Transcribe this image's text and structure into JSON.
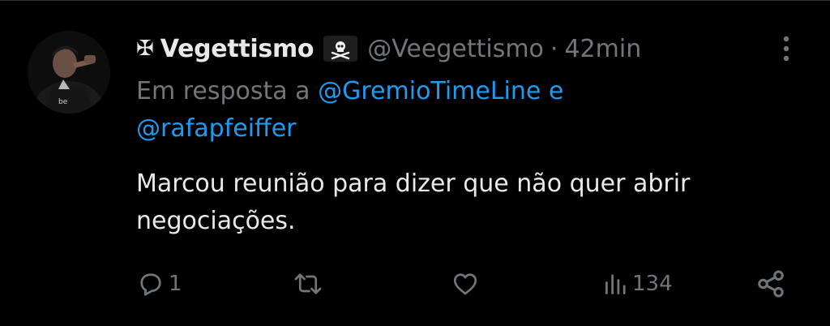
{
  "tweet": {
    "cross_symbol": "✠",
    "display_name": "Vegettismo",
    "handle": "@Veegettismo",
    "separator": "·",
    "time": "42min",
    "reply_prefix": "Em resposta a",
    "reply_mention_1": "@GremioTimeLine",
    "reply_conjunction": "e",
    "reply_mention_2": "@rafapfeiffer",
    "text_line_1": "Marcou reunião para dizer que não quer abrir",
    "text_line_2": "negociações."
  },
  "actions": {
    "reply_count": "1",
    "retweet_count": "",
    "like_count": "",
    "views_count": "134"
  },
  "icons": {
    "more": "more-vertical-icon",
    "reply": "reply-icon",
    "retweet": "retweet-icon",
    "like": "heart-icon",
    "views": "views-bar-chart-icon",
    "share": "share-icon",
    "flag": "pirate-flag-icon"
  },
  "colors": {
    "background": "#000000",
    "text": "#e7e9ea",
    "muted": "#71767b",
    "link": "#1d9bf0"
  }
}
